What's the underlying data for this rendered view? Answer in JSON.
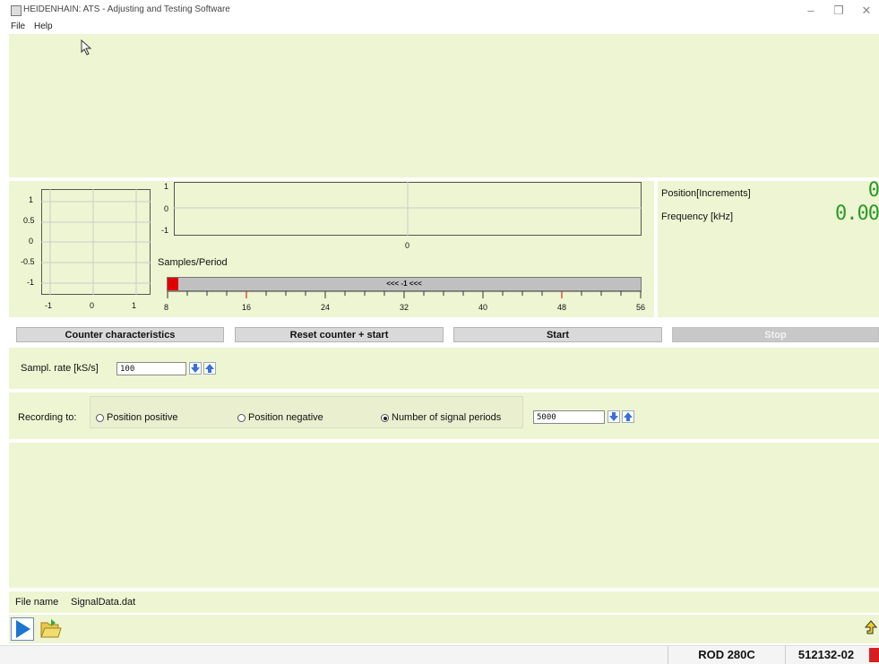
{
  "window": {
    "title": "HEIDENHAIN: ATS - Adjusting and Testing Software"
  },
  "menu": {
    "items": [
      "File",
      "Help"
    ]
  },
  "scope": {
    "xy_plot": {
      "y_ticks": [
        "1",
        "0.5",
        "0",
        "-0.5",
        "-1"
      ],
      "x_ticks": [
        "-1",
        "0",
        "1"
      ]
    },
    "wave_plot": {
      "y_ticks": [
        "1",
        "0",
        "-1"
      ],
      "x_ticks": [
        "0"
      ]
    },
    "samples_label": "Samples/Period",
    "bar_text": "<<< -1 <<<",
    "scale_ticks": [
      "8",
      "16",
      "24",
      "32",
      "40",
      "48",
      "56"
    ],
    "scale_value": 8
  },
  "readout": {
    "position_label": "Position[Increments]",
    "position_value": "0",
    "frequency_label": "Frequency [kHz]",
    "frequency_value": "0.00"
  },
  "buttons": {
    "counter": "Counter characteristics",
    "reset": "Reset counter + start",
    "start": "Start",
    "stop": "Stop"
  },
  "rate": {
    "label": "Sampl. rate [kS/s]",
    "value": "100"
  },
  "recording": {
    "label": "Recording to:",
    "options": [
      "Position positive",
      "Position negative",
      "Number of signal periods"
    ],
    "selected_index": 2,
    "periods_value": "5000"
  },
  "file": {
    "label": "File name",
    "value": "SignalData.dat"
  },
  "status": {
    "model": "ROD 280C",
    "id": "512132-02"
  },
  "colors": {
    "panel": "#eef5d2",
    "accent_green": "#2a9a2a",
    "scale_marker": "#e00000"
  }
}
